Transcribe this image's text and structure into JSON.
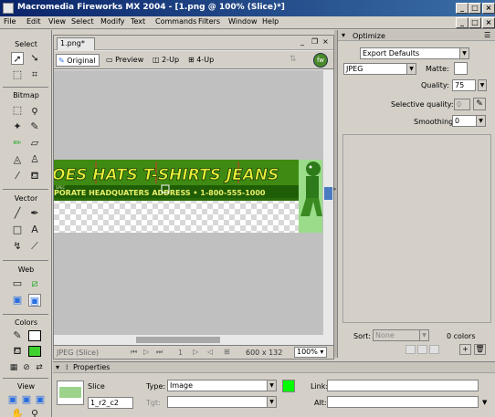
{
  "window": {
    "title": "Macromedia Fireworks MX 2004 - [1.png @ 100% (Slice)*]",
    "minimize": "_",
    "maximize": "□",
    "close": "×"
  },
  "menu": [
    "File",
    "Edit",
    "View",
    "Select",
    "Modify",
    "Text",
    "Commands",
    "Filters",
    "Window",
    "Help"
  ],
  "tools": {
    "select": "Select",
    "bitmap": "Bitmap",
    "vector": "Vector",
    "web": "Web",
    "colors": "Colors",
    "view": "View"
  },
  "document": {
    "tab": "1.png*",
    "views": [
      "Original",
      "Preview",
      "2-Up",
      "4-Up"
    ],
    "banner": {
      "menu_text": "OES  HATS  T-SHIRTS  JEANS",
      "address_text": "PORATE HEADQUATERS  ADDRESS • 1-800-555-1000",
      "small_text": "SPEC"
    },
    "status": {
      "format": "JPEG (Slice)",
      "page": "1",
      "size": "600 x 132",
      "zoom": "100%"
    }
  },
  "optimize": {
    "title": "Optimize",
    "preset": "Export Defaults",
    "format": "JPEG",
    "matte_label": "Matte:",
    "quality_label": "Quality:",
    "quality": "75",
    "selective_label": "Selective quality:",
    "selective": "0",
    "smoothing_label": "Smoothing:",
    "smoothing": "0",
    "sort_label": "Sort:",
    "sort": "None",
    "colors_count": "0 colors"
  },
  "properties": {
    "title": "Properties",
    "object": "Slice",
    "name": "1_r2_c2",
    "type_label": "Type:",
    "type": "Image",
    "url_label": "Link:",
    "alt_label": "Alt:",
    "target_label": "Tgt:"
  },
  "colors": {
    "stroke": "#000000",
    "fill": "#3fd12e",
    "slice": "#00ff00",
    "titlebar": "#0a246a"
  }
}
